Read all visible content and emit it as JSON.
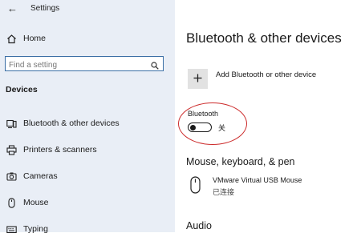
{
  "window": {
    "title": "Settings",
    "back_glyph": "←"
  },
  "sidebar": {
    "home_label": "Home",
    "search_placeholder": "Find a setting",
    "section_heading": "Devices",
    "items": [
      {
        "label": "Bluetooth & other devices",
        "icon": "bluetooth-devices-icon"
      },
      {
        "label": "Printers & scanners",
        "icon": "printer-icon"
      },
      {
        "label": "Cameras",
        "icon": "camera-icon"
      },
      {
        "label": "Mouse",
        "icon": "mouse-icon"
      },
      {
        "label": "Typing",
        "icon": "keyboard-icon"
      }
    ]
  },
  "main": {
    "page_title": "Bluetooth & other devices",
    "add_device_label": "Add Bluetooth or other device",
    "bluetooth": {
      "label": "Bluetooth",
      "state_label": "关",
      "enabled": false
    },
    "mouse_section_title": "Mouse, keyboard, & pen",
    "device": {
      "name": "VMware Virtual USB Mouse",
      "status": "已连接"
    },
    "audio_section_title": "Audio"
  },
  "colors": {
    "sidebar_bg": "#e9eef6",
    "search_border": "#3a6ea5",
    "annotation_circle": "#cc2b2b",
    "add_button_bg": "#e2e2e2"
  }
}
